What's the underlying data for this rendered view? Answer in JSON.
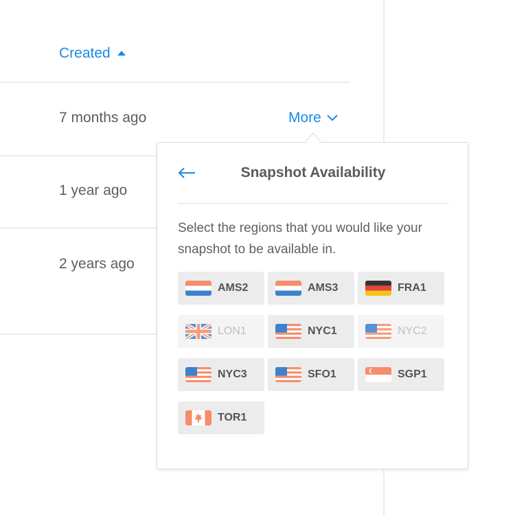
{
  "table": {
    "created_header": "Created",
    "sort_icon": "caret-up-icon",
    "rows": [
      {
        "created": "7 months ago"
      },
      {
        "created": "1 year ago"
      },
      {
        "created": "2 years ago"
      }
    ],
    "more_label": "More",
    "more_icon": "chevron-down-icon"
  },
  "popover": {
    "back_icon": "arrow-left-icon",
    "title": "Snapshot Availability",
    "description": "Select the regions that you would like your snapshot to be available in.",
    "regions": [
      {
        "code": "AMS2",
        "flag": "netherlands-flag-icon",
        "selected": true
      },
      {
        "code": "AMS3",
        "flag": "netherlands-flag-icon",
        "selected": true
      },
      {
        "code": "FRA1",
        "flag": "germany-flag-icon",
        "selected": true
      },
      {
        "code": "LON1",
        "flag": "uk-flag-icon",
        "selected": false
      },
      {
        "code": "NYC1",
        "flag": "usa-flag-icon",
        "selected": true
      },
      {
        "code": "NYC2",
        "flag": "usa-flag-icon",
        "selected": false
      },
      {
        "code": "NYC3",
        "flag": "usa-flag-icon",
        "selected": true
      },
      {
        "code": "SFO1",
        "flag": "usa-flag-icon",
        "selected": true
      },
      {
        "code": "SGP1",
        "flag": "singapore-flag-icon",
        "selected": true
      },
      {
        "code": "TOR1",
        "flag": "canada-flag-icon",
        "selected": true
      }
    ]
  },
  "colors": {
    "accent": "#1a8ae6",
    "text": "#5c5c5c",
    "tile_bg": "#ececec",
    "flag_orange": "#f58d6b",
    "flag_blue": "#3c82cd"
  }
}
